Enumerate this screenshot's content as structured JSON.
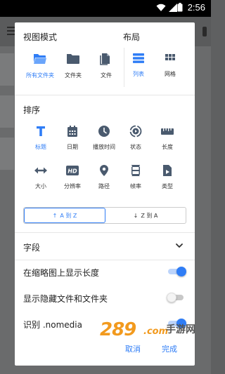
{
  "status_bar": {
    "time": "2:56"
  },
  "view_mode": {
    "title": "视图模式",
    "options": [
      {
        "label": "所有文件夹",
        "icon": "folder-open-icon",
        "selected": true
      },
      {
        "label": "文件夹",
        "icon": "folder-icon",
        "selected": false
      },
      {
        "label": "文件",
        "icon": "file-copy-icon",
        "selected": false
      }
    ]
  },
  "layout": {
    "title": "布局",
    "options": [
      {
        "label": "列表",
        "icon": "list-icon",
        "selected": true
      },
      {
        "label": "网格",
        "icon": "grid-icon",
        "selected": false
      }
    ]
  },
  "sort": {
    "title": "排序",
    "options": [
      {
        "label": "标题",
        "icon": "title-icon",
        "selected": true
      },
      {
        "label": "日期",
        "icon": "calendar-icon",
        "selected": false
      },
      {
        "label": "播放时间",
        "icon": "clock-icon",
        "selected": false
      },
      {
        "label": "状态",
        "icon": "status-icon",
        "selected": false
      },
      {
        "label": "长度",
        "icon": "ruler-icon",
        "selected": false
      },
      {
        "label": "大小",
        "icon": "size-arrows-icon",
        "selected": false
      },
      {
        "label": "分辨率",
        "icon": "hd-icon",
        "selected": false
      },
      {
        "label": "路径",
        "icon": "location-pin-icon",
        "selected": false
      },
      {
        "label": "帧率",
        "icon": "film-icon",
        "selected": false
      },
      {
        "label": "类型",
        "icon": "file-play-icon",
        "selected": false
      }
    ],
    "order": {
      "ascending": "A 到 Z",
      "descending": "Z 到 A",
      "selected": "ascending"
    }
  },
  "fields": {
    "title": "字段"
  },
  "settings": [
    {
      "label": "在缩略图上显示长度",
      "enabled": true
    },
    {
      "label": "显示隐藏文件和文件夹",
      "enabled": false
    },
    {
      "label": "识别 .nomedia",
      "enabled": true
    }
  ],
  "actions": {
    "cancel": "取消",
    "done": "完成"
  },
  "watermark": {
    "number": "289",
    "suffix": ".com",
    "name": "手游网"
  },
  "colors": {
    "accent": "#2f7df6",
    "icon": "#4a5a6e",
    "watermark": "#f29a1e"
  }
}
